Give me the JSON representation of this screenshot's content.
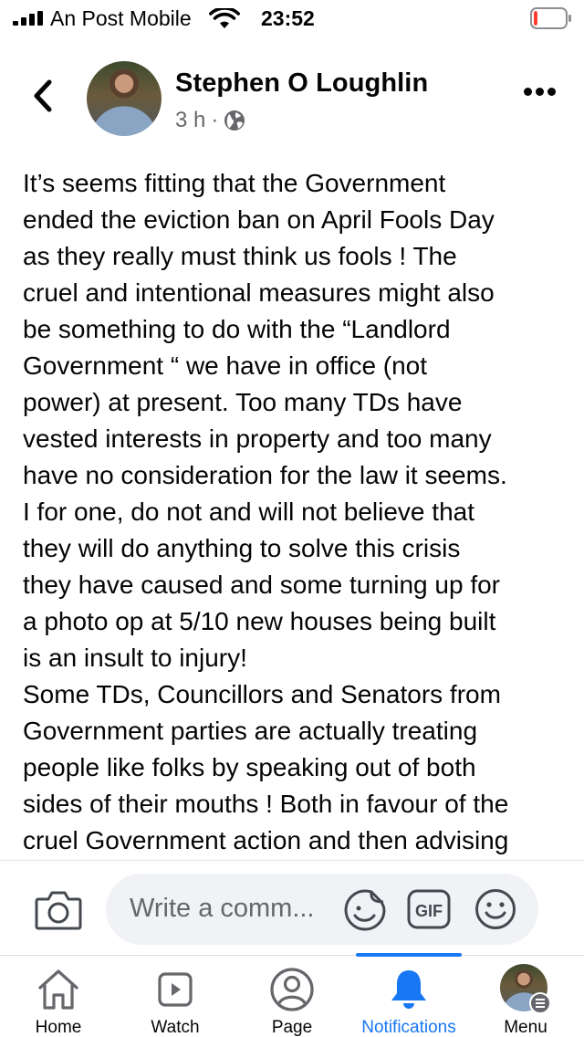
{
  "status_bar": {
    "carrier": "An Post Mobile",
    "time": "23:52",
    "battery_level": 0.12,
    "battery_color": "#ff3b30"
  },
  "post": {
    "author": "Stephen O Loughlin",
    "time_ago": "3 h",
    "separator": "·",
    "audience_icon": "globe-icon",
    "body": "It’s seems fitting that the Government\nended the eviction ban on April Fools Day\nas they really must think us fools ! The\ncruel and intentional measures might also\nbe something to do with the “Landlord\nGovernment “ we have in office (not\npower) at present. Too many TDs have\nvested interests in property and too many\nhave no consideration for the law it seems.\nI for one, do not and will not believe that\nthey will do anything to solve this crisis\nthey have caused and some turning up for\na photo op at 5/10 new houses being built\nis an insult to injury!\nSome TDs, Councillors and Senators from\nGovernment parties are actually treating\npeople like folks by speaking out of both\nsides of their mouths ! Both in favour of the\ncruel Government action and then advising"
  },
  "comment_bar": {
    "placeholder": "Write a comm...",
    "gif_label": "GIF"
  },
  "tabs": [
    {
      "label": "Home",
      "icon": "home-icon"
    },
    {
      "label": "Watch",
      "icon": "watch-icon"
    },
    {
      "label": "Page",
      "icon": "page-icon"
    },
    {
      "label": "Notifications",
      "icon": "bell-icon",
      "active": true
    },
    {
      "label": "Menu",
      "icon": "menu-avatar"
    }
  ],
  "colors": {
    "accent": "#1877f2",
    "secondary_text": "#65676b",
    "input_bg": "#f0f2f5"
  }
}
